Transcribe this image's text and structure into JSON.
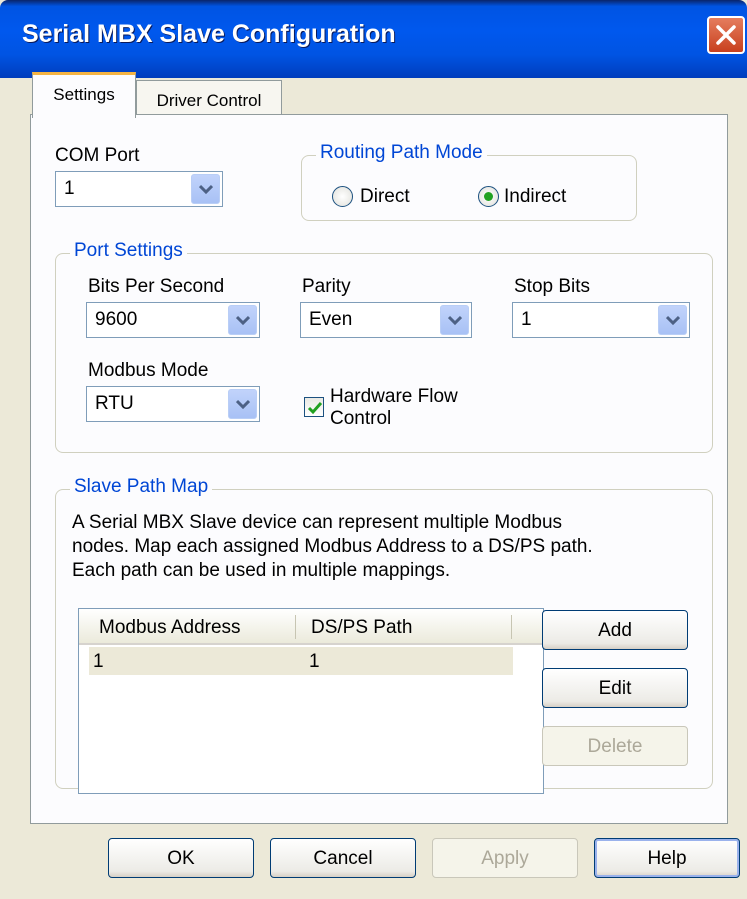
{
  "window": {
    "title": "Serial MBX Slave Configuration"
  },
  "tabs": [
    {
      "label": "Settings",
      "active": true
    },
    {
      "label": "Driver Control",
      "active": false
    }
  ],
  "com_port": {
    "label": "COM Port",
    "value": "1"
  },
  "routing": {
    "legend": "Routing Path Mode",
    "options": [
      {
        "label": "Direct",
        "selected": false
      },
      {
        "label": "Indirect",
        "selected": true
      }
    ]
  },
  "port_settings": {
    "legend": "Port Settings",
    "bits_label": "Bits Per Second",
    "bits_value": "9600",
    "parity_label": "Parity",
    "parity_value": "Even",
    "stop_label": "Stop Bits",
    "stop_value": "1",
    "modbus_label": "Modbus Mode",
    "modbus_value": "RTU",
    "flow_label_line1": "Hardware Flow",
    "flow_label_line2": "Control",
    "flow_checked": true
  },
  "slave_map": {
    "legend": "Slave Path Map",
    "desc_line1": "A Serial MBX Slave device can represent multiple Modbus",
    "desc_line2": "nodes. Map each assigned Modbus Address to a DS/PS path.",
    "desc_line3": "Each path can be used in multiple mappings.",
    "columns": [
      "Modbus Address",
      "DS/PS Path"
    ],
    "rows": [
      {
        "address": "1",
        "path": "1"
      }
    ],
    "add_label": "Add",
    "edit_label": "Edit",
    "delete_label": "Delete"
  },
  "footer": {
    "ok": "OK",
    "cancel": "Cancel",
    "apply": "Apply",
    "help": "Help"
  },
  "colors": {
    "titlebar": "#0054e3",
    "group_legend": "#0046d5",
    "dialog_bg": "#ece9d8",
    "radio_dot": "#21a121",
    "tab_accent": "#f5b443"
  }
}
